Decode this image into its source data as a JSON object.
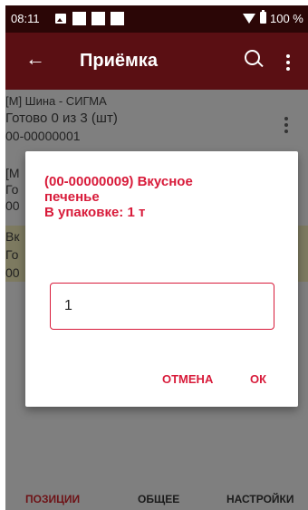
{
  "status_bar": {
    "time": "08:11",
    "battery": "100 %"
  },
  "app_bar": {
    "title": "Приёмка"
  },
  "list_items": [
    {
      "lines": [
        "[М] Шина - СИГМА",
        "Готово 0 из 3 (шт)",
        "00-00000001"
      ]
    },
    {
      "lines": [
        "[М",
        "Го",
        "00"
      ]
    },
    {
      "lines": [
        "Вк",
        "Го",
        "00"
      ]
    }
  ],
  "dialog": {
    "title_line1": "(00-00000009)  Вкусное",
    "title_line2": "печенье",
    "title_line3": "В упаковке: 1 т",
    "input_value": "1",
    "cancel_label": "ОТМЕНА",
    "ok_label": "ОК"
  },
  "bottom_nav": {
    "tabs": [
      {
        "label": "ПОЗИЦИИ",
        "active": true
      },
      {
        "label": "ОБЩЕЕ",
        "active": false
      },
      {
        "label": "НАСТРОЙКИ",
        "active": false
      }
    ]
  },
  "colors": {
    "accent": "#d81b3a",
    "app_bar": "#5a0f13",
    "status_bar": "#2b0606",
    "highlight_row": "#7d7a60",
    "scrim": "#7f7f7f"
  },
  "icons": [
    "image-icon",
    "wifi-icon",
    "battery-icon",
    "back-arrow-icon",
    "search-icon",
    "overflow-menu-icon"
  ]
}
